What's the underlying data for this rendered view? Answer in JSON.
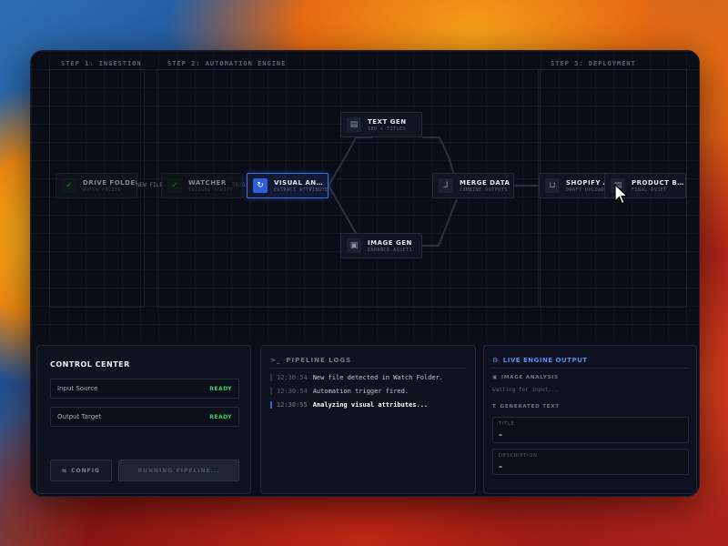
{
  "stages": {
    "ingestion": "STEP 1: INGESTION",
    "automation": "STEP 2: AUTOMATION ENGINE",
    "deployment": "STEP 3: DEPLOYMENT"
  },
  "nodes": {
    "drive_folder": {
      "title": "DRIVE FOLDER",
      "subtitle": "WATCH FOLDER",
      "icon": "check-icon"
    },
    "watcher": {
      "title": "WATCHER",
      "subtitle": "TRIGGER SCRIPT",
      "icon": "check-icon"
    },
    "visual_analysis": {
      "title": "VISUAL ANALYSIS",
      "subtitle": "EXTRACT ATTRIBUTES",
      "icon": "spinner-icon"
    },
    "text_gen": {
      "title": "TEXT GEN",
      "subtitle": "SEO + TITLES",
      "icon": "document-icon"
    },
    "image_gen": {
      "title": "IMAGE GEN",
      "subtitle": "ENHANCE ASSETS",
      "icon": "image-icon"
    },
    "merge_data": {
      "title": "MERGE DATA",
      "subtitle": "COMBINE OUTPUTS",
      "icon": "merge-icon"
    },
    "shopify_api": {
      "title": "SHOPIFY API",
      "subtitle": "DRAFT UPLOAD",
      "icon": "cart-icon"
    },
    "product_brief": {
      "title": "PRODUCT BRIEF",
      "subtitle": "FINAL ASSET",
      "icon": "document-icon"
    }
  },
  "edge_labels": {
    "new_file": "NEW FILE",
    "trigger": "TRIG"
  },
  "control_center": {
    "title": "CONTROL CENTER",
    "rows": [
      {
        "label": "Input Source",
        "status": "READY"
      },
      {
        "label": "Output Target",
        "status": "READY"
      }
    ],
    "config_label": "CONFIG",
    "run_label": "RUNNING PIPELINE..."
  },
  "logs": {
    "title": "PIPELINE LOGS",
    "lines": [
      {
        "time": "12:30:54",
        "text": "New file detected in Watch Folder."
      },
      {
        "time": "12:30:54",
        "text": "Automation trigger fired."
      },
      {
        "time": "12:30:55",
        "text": "Analyzing visual attributes..."
      }
    ]
  },
  "output": {
    "title": "LIVE ENGINE OUTPUT",
    "image_analysis_label": "IMAGE ANALYSIS",
    "waiting_text": "waiting for input...",
    "generated_text_label": "GENERATED TEXT",
    "fields": [
      {
        "label": "TITLE",
        "value": "–"
      },
      {
        "label": "DESCRIPTION",
        "value": "–"
      }
    ]
  },
  "colors": {
    "accent": "#3d6fe0",
    "ready": "#39d06c",
    "output_title": "#5b8cf0"
  }
}
